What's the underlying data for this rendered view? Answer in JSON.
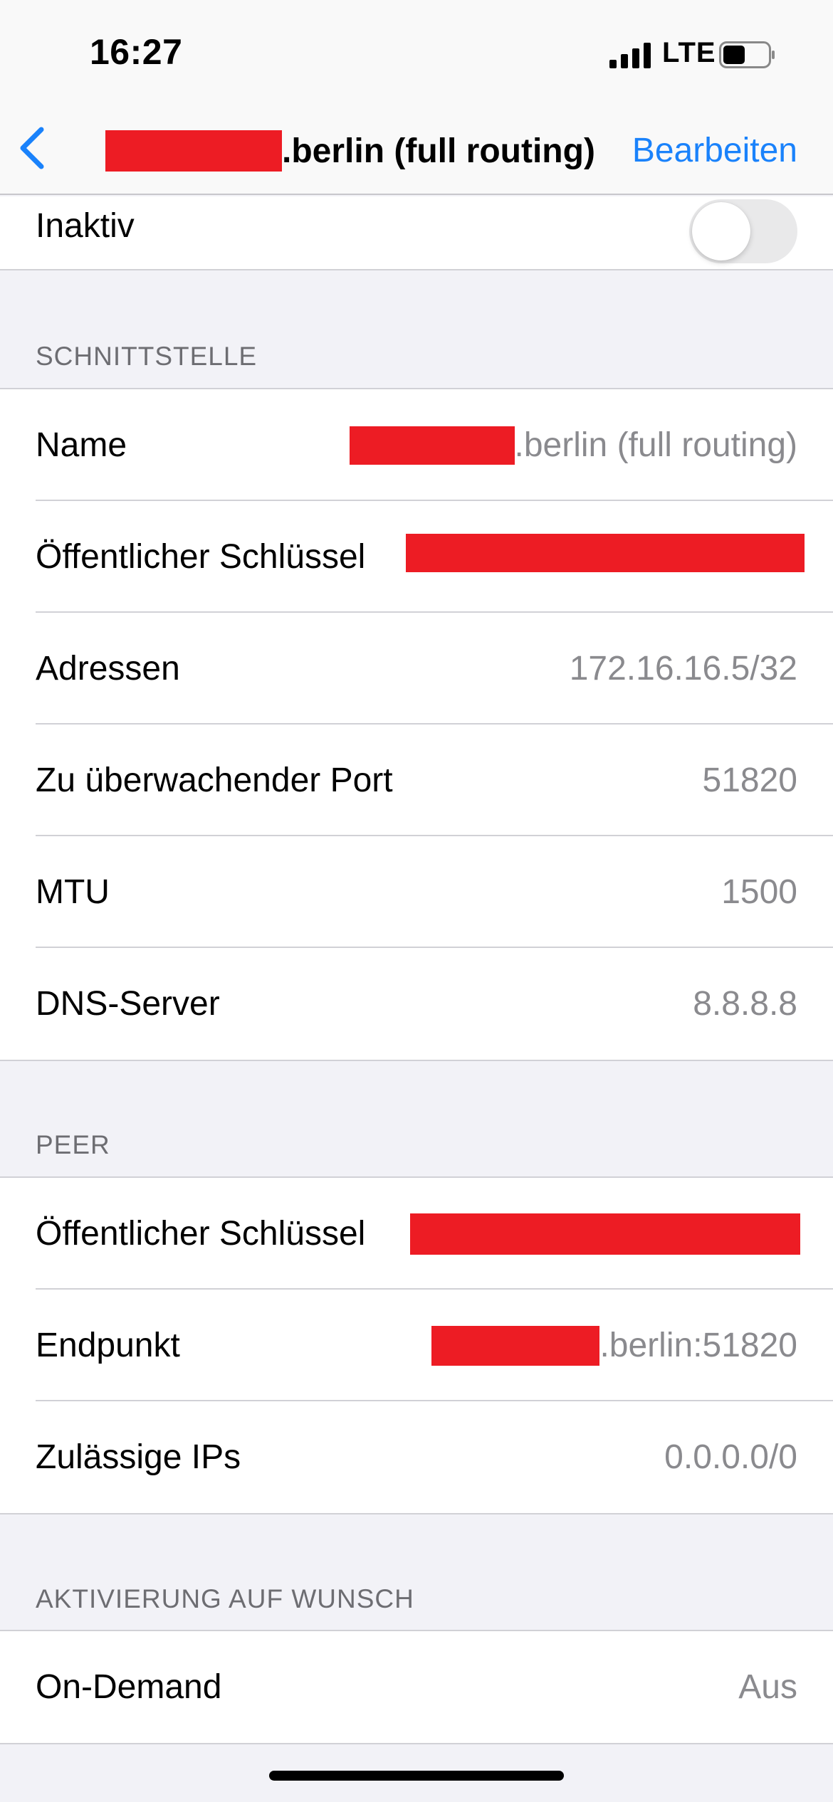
{
  "status_bar": {
    "time": "16:27",
    "network": "LTE",
    "signal_icon": "cellular-signal-icon",
    "battery_icon": "battery-icon"
  },
  "nav": {
    "back_icon": "chevron-left-icon",
    "title_suffix": ".berlin (full routing)",
    "edit_label": "Bearbeiten",
    "accent_color": "#1a82fb"
  },
  "status_row": {
    "label": "Inaktiv",
    "toggle_on": false
  },
  "interface": {
    "header": "SCHNITTSTELLE",
    "name_label": "Name",
    "name_value_suffix": ".berlin (full routing)",
    "public_key_label": "Öffentlicher Schlüssel",
    "addresses_label": "Adressen",
    "addresses_value": "172.16.16.5/32",
    "listen_port_label": "Zu überwachender Port",
    "listen_port_value": "51820",
    "mtu_label": "MTU",
    "mtu_value": "1500",
    "dns_label": "DNS-Server",
    "dns_value": "8.8.8.8"
  },
  "peer": {
    "header": "PEER",
    "public_key_label": "Öffentlicher Schlüssel",
    "endpoint_label": "Endpunkt",
    "endpoint_value_suffix": ".berlin:51820",
    "allowed_ips_label": "Zulässige IPs",
    "allowed_ips_value": "0.0.0.0/0"
  },
  "on_demand": {
    "header": "AKTIVIERUNG AUF WUNSCH",
    "label": "On-Demand",
    "value": "Aus"
  },
  "redaction_color": "#ed1c24"
}
